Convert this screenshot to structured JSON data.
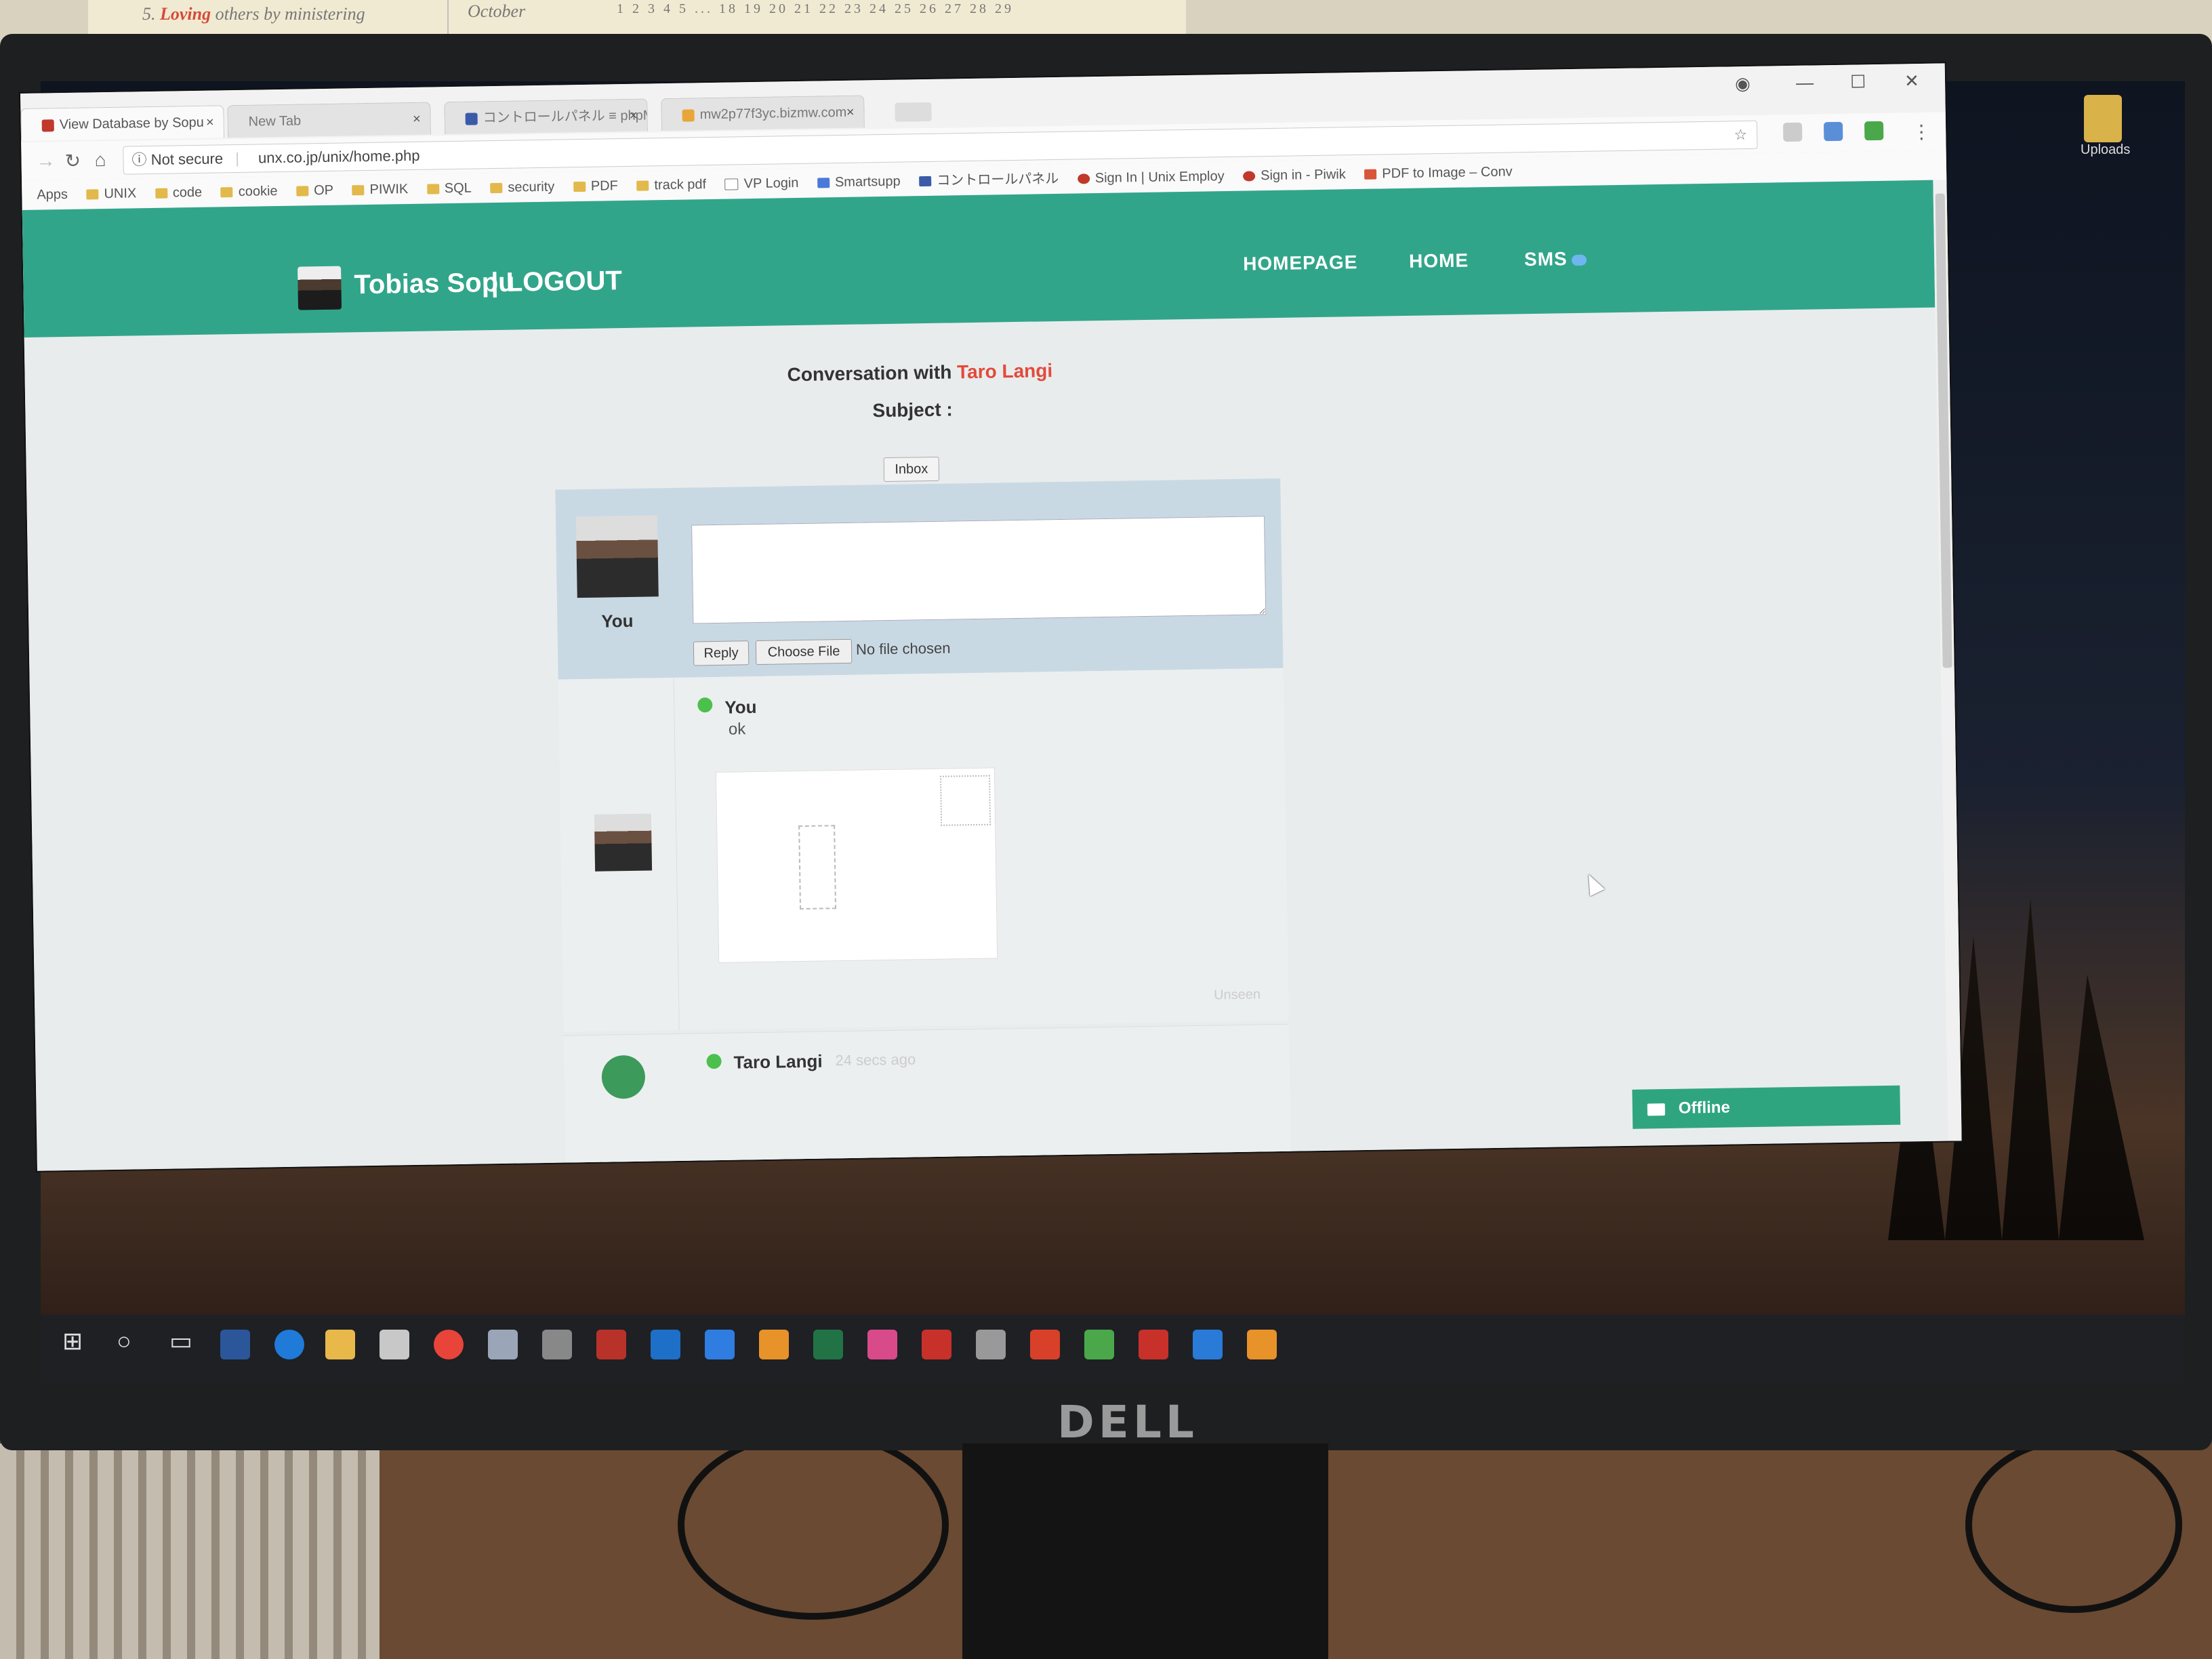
{
  "calendar": {
    "quote": "5. Loving others by ministering",
    "quote_highlight": "Loving",
    "month": "October",
    "days": "1 2 3 4 5 ... 18 19 20 21 22 23 24 25 26 27 28 29"
  },
  "desktop": {
    "icon_label": "Uploads"
  },
  "browser": {
    "tabs": [
      {
        "label": "View Database by Sopu",
        "active": true
      },
      {
        "label": "New Tab",
        "active": false
      },
      {
        "label": "コントロールパネル ≡ phpM",
        "active": false
      },
      {
        "label": "mw2p77f3yc.bizmw.com",
        "active": false
      }
    ],
    "security_label": "Not secure",
    "url": "unx.co.jp/unix/home.php",
    "bookmarks": [
      "Apps",
      "UNIX",
      "code",
      "cookie",
      "OP",
      "PIWIK",
      "SQL",
      "security",
      "PDF",
      "track pdf",
      "VP Login",
      "Smartsupp",
      "コントロールパネル",
      "Sign In | Unix Employ",
      "Sign in - Piwik",
      "PDF to Image – Conv"
    ]
  },
  "header": {
    "user_name": "Tobias Sopu",
    "logout": "| LOGOUT",
    "nav": [
      "HOMEPAGE",
      "HOME",
      "SMS"
    ]
  },
  "conversation": {
    "title_prefix": "Conversation with",
    "partner": "Taro Langi",
    "subject_label": "Subject :",
    "inbox_button": "Inbox",
    "reply_user_label": "You",
    "reply_button": "Reply",
    "choose_file_button": "Choose File",
    "file_status": "No file chosen",
    "messages": [
      {
        "sender": "You",
        "body": "ok",
        "status": "Unseen"
      },
      {
        "sender": "Taro Langi",
        "time": "24 secs ago"
      }
    ]
  },
  "chat_widget": {
    "status": "Offline"
  },
  "monitor": {
    "brand": "DELL"
  },
  "colors": {
    "header_bg": "#31a58a",
    "accent_red": "#e24a3a",
    "online_dot": "#4cc04c"
  }
}
